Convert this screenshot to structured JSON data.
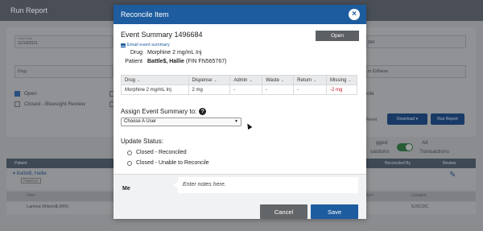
{
  "background": {
    "page_title": "Run Report",
    "start_date_label": "Start Date",
    "start_date_value": "11/14/2021",
    "drug_label": "Drug",
    "options": [
      "Open",
      "Closed - Bluesight Review"
    ],
    "summary_id_fragment": "684",
    "fragment_m_id_name": "m ID/Name",
    "fragment_cile": "cile",
    "reset_label": "Reset",
    "download_label": "Download",
    "run_report_label": "Run Report",
    "fragment_gged": "gged",
    "fragment_sactions": "sactions",
    "all_transactions_label_1": "All",
    "all_transactions_label_2": "Transactions",
    "table_headers": [
      "Patient",
      "Reconciled By",
      "Review"
    ],
    "patient_link": "Battle$, Hallie",
    "patient_badge": "FN565767",
    "sub_headers": [
      "User",
      "turn",
      "Location"
    ],
    "row_user": "Larissa Wilson$ (RN)",
    "row_location": "5JSCDC"
  },
  "modal": {
    "title": "Reconcile Item",
    "close_icon": "close-icon",
    "event_summary_title": "Event Summary 1496684",
    "open_button": "Open",
    "email_link": "Email event summary",
    "drug_label": "Drug",
    "drug_value": "Morphine 2 mg/mL Inj",
    "patient_label": "Patient",
    "patient_name": "Battle$, Hallie",
    "patient_fin": "(FIN FN565767)",
    "table": {
      "headers": [
        "Drug",
        "Dispense",
        "Admin",
        "Waste",
        "Return",
        "Missing"
      ],
      "rows": [
        [
          "Morphine 2 mg/mL Inj",
          "2 mg",
          "-",
          "-",
          "-",
          "-2 mg"
        ]
      ]
    },
    "assign_label": "Assign Event Summary to:",
    "assign_select_value": "Choose A User",
    "update_status_label": "Update Status:",
    "status_options": [
      "Closed - Reconciled",
      "Closed - Unable to Reconcile"
    ],
    "notes_author": "Me",
    "notes_placeholder": "Enter notes here.",
    "cancel_button": "Cancel",
    "save_button": "Save",
    "colors": {
      "header": "#1d5c9e",
      "missing": "#c0192a",
      "cancel": "#636669"
    }
  }
}
